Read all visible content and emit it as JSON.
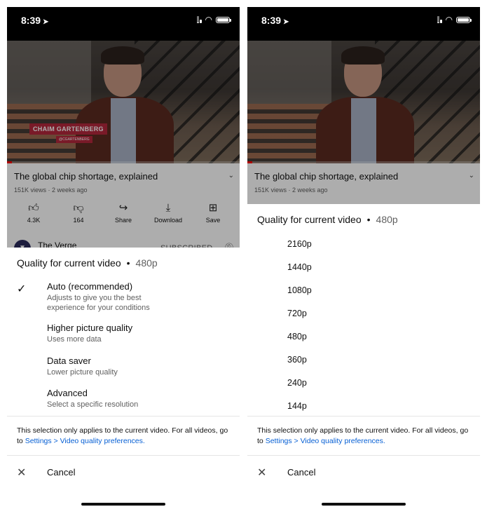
{
  "screens": [
    {
      "status": {
        "time": "8:39"
      },
      "video": {
        "overlay_name": "CHAIM GARTENBERG",
        "overlay_handle": "@CGARTENBERG",
        "title": "The global chip shortage, explained",
        "meta": "151K views · 2 weeks ago",
        "progress": 0.02
      },
      "actions": [
        {
          "icon": "like-icon",
          "label": "4.3K"
        },
        {
          "icon": "dislike-icon",
          "label": "164"
        },
        {
          "icon": "share-icon",
          "label": "Share"
        },
        {
          "icon": "download-icon",
          "label": "Download"
        },
        {
          "icon": "save-icon",
          "label": "Save"
        }
      ],
      "channel": {
        "name": "The Verge",
        "subscribe": "SUBSCRIBED"
      },
      "sheet": {
        "title": "Quality for current video",
        "current": "480p",
        "options": [
          {
            "label": "Auto (recommended)",
            "desc": "Adjusts to give you the best experience for your conditions",
            "selected": true
          },
          {
            "label": "Higher picture quality",
            "desc": "Uses more data",
            "selected": false
          },
          {
            "label": "Data saver",
            "desc": "Lower picture quality",
            "selected": false
          },
          {
            "label": "Advanced",
            "desc": "Select a specific resolution",
            "selected": false
          }
        ],
        "note_text": "This selection only applies to the current video. For all videos, go to",
        "note_link": "Settings > Video quality preferences.",
        "cancel": "Cancel"
      }
    },
    {
      "status": {
        "time": "8:39"
      },
      "video": {
        "title": "The global chip shortage, explained",
        "meta": "151K views · 2 weeks ago",
        "progress": 0.02
      },
      "sheet": {
        "title": "Quality for current video",
        "current": "480p",
        "resolutions": [
          "2160p",
          "1440p",
          "1080p",
          "720p",
          "480p",
          "360p",
          "240p",
          "144p"
        ],
        "note_text": "This selection only applies to the current video. For all videos, go to",
        "note_link": "Settings > Video quality preferences.",
        "cancel": "Cancel"
      }
    }
  ]
}
